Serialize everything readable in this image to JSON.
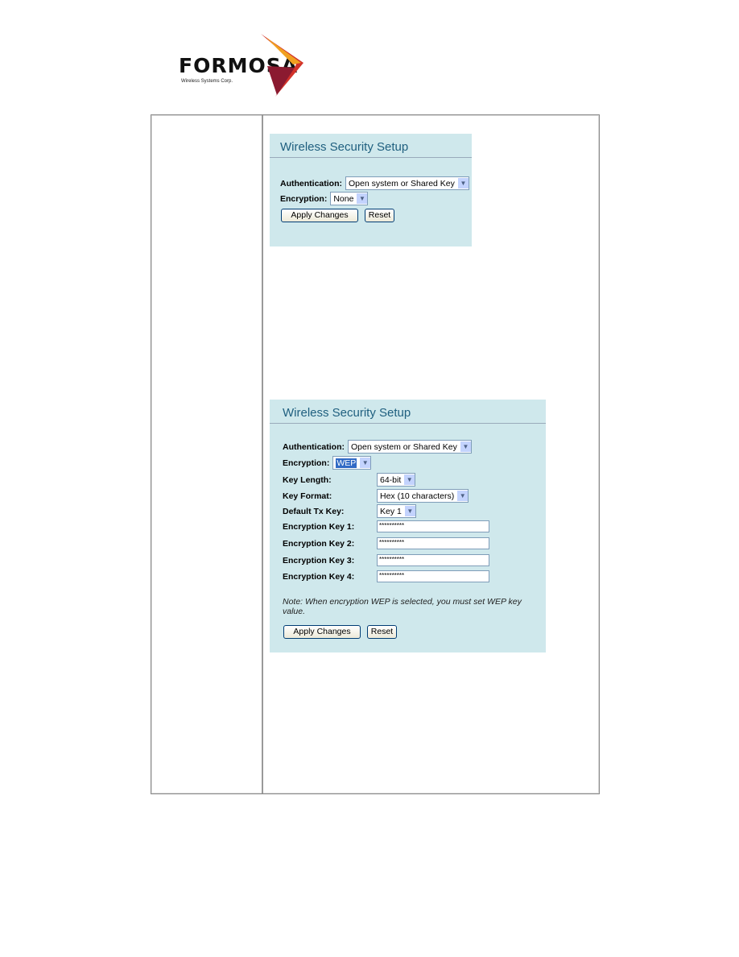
{
  "logo": {
    "brand": "FORMOSA",
    "tagline": "Wireless Systems Corp."
  },
  "panel1": {
    "title": "Wireless Security Setup",
    "authentication_label": "Authentication:",
    "authentication_value": "Open system or Shared Key",
    "encryption_label": "Encryption:",
    "encryption_value": "None",
    "apply_label": "Apply Changes",
    "reset_label": "Reset"
  },
  "panel2": {
    "title": "Wireless Security Setup",
    "authentication_label": "Authentication:",
    "authentication_value": "Open system or Shared Key",
    "encryption_label": "Encryption:",
    "encryption_value": "WEP",
    "key_length_label": "Key Length:",
    "key_length_value": "64-bit",
    "key_format_label": "Key Format:",
    "key_format_value": "Hex (10 characters)",
    "default_tx_label": "Default Tx Key:",
    "default_tx_value": "Key 1",
    "keys": [
      {
        "label": "Encryption Key 1:",
        "value": "**********"
      },
      {
        "label": "Encryption Key 2:",
        "value": "**********"
      },
      {
        "label": "Encryption Key 3:",
        "value": "**********"
      },
      {
        "label": "Encryption Key 4:",
        "value": "**********"
      }
    ],
    "note": "Note: When encryption WEP is selected, you must set WEP key value.",
    "apply_label": "Apply Changes",
    "reset_label": "Reset"
  },
  "icons": {
    "dropdown": "chevron-down-icon"
  }
}
